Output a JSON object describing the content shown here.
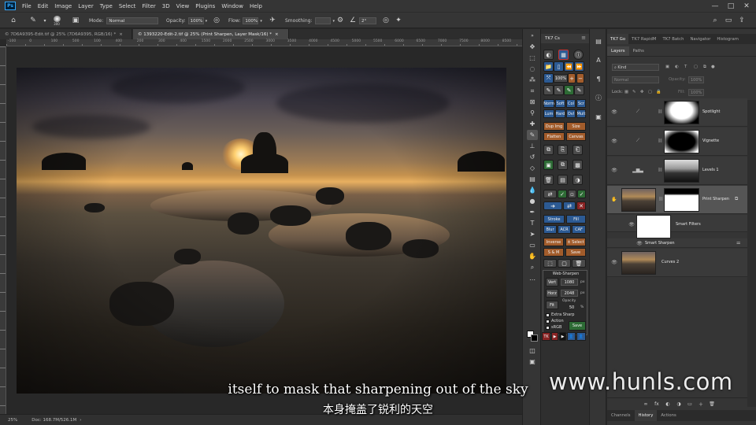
{
  "menubar": {
    "logo": "Ps",
    "items": [
      "File",
      "Edit",
      "Image",
      "Layer",
      "Type",
      "Select",
      "Filter",
      "3D",
      "View",
      "Plugins",
      "Window",
      "Help"
    ],
    "window_controls": [
      "—",
      "□",
      "✕"
    ]
  },
  "options": {
    "brush_size": "300",
    "mode_label": "Mode:",
    "mode_value": "Normal",
    "opacity_label": "Opacity:",
    "opacity_value": "100%",
    "flow_label": "Flow:",
    "flow_value": "100%",
    "smoothing_label": "Smoothing:",
    "angle_value": "2°"
  },
  "document_tabs": [
    {
      "label": "© 7D6A9395-Edit.tif @ 25% (7D6A9395, RGB/16) *",
      "close": "×"
    },
    {
      "label": "© 1393220-Edit-2.tif @ 25% (Print Sharpen, Layer Mask/16) *",
      "close": "×"
    }
  ],
  "ruler_ticks": [
    "-100",
    "0",
    "100",
    "500",
    "100",
    "400",
    "200",
    "300",
    "400",
    "1500",
    "2000",
    "2500",
    "3000",
    "3500",
    "4000",
    "4500",
    "5000",
    "5500",
    "6000",
    "6500",
    "7000",
    "7500",
    "8000",
    "8500"
  ],
  "status": {
    "zoom": "25%",
    "doc_size": "Doc: 168.7M/526.1M"
  },
  "subtitles": {
    "english": "itself to mask that sharpening out of the sky",
    "chinese": "本身掩盖了锐利的天空"
  },
  "watermark": "www.hunls.com",
  "tk7": {
    "tab_label": "TK7 Cs",
    "blend_row1": [
      "Norm",
      "Soft",
      "Col",
      "Scr"
    ],
    "blend_row2": [
      "Lum",
      "Hard",
      "Ovl",
      "Mult"
    ],
    "zoom_value": "100%",
    "dup_img": "Dup Img",
    "size": "Size",
    "flatten": "Flatten",
    "canvas": "Canvas",
    "stroke": "Stroke",
    "fill": "Fill",
    "blur": "Blur",
    "acr": "ACR",
    "caf": "CAF",
    "inverse": "Inverse",
    "select": "± Select",
    "s_m": "S & M",
    "save": "Save",
    "web_sharpen": {
      "title": "Web-Sharpen",
      "vert_label": "Vert",
      "vert_value": "1080",
      "vert_unit": "px",
      "horz_label": "Horz",
      "horz_value": "2048",
      "horz_unit": "px",
      "fit_label": "Fit",
      "opacity_label": "Opacity",
      "opacity_value": "50",
      "opacity_unit": "%",
      "extra_sharp": "Extra Sharp",
      "action": "Action",
      "srgb": "sRGB",
      "save": "Save"
    },
    "footer": [
      "TK",
      "▶",
      "▶",
      "👤",
      "👤"
    ]
  },
  "layers_panel": {
    "top_tabs": [
      "TK7 Go",
      "TK7 RapidM",
      "TK7 Batch",
      "Navigator",
      "Histogram"
    ],
    "sub_tabs": [
      "Layers",
      "Paths"
    ],
    "kind_label": "Kind",
    "blend_mode": "Normal",
    "opacity_label": "Opacity:",
    "opacity_value": "100%",
    "lock_label": "Lock:",
    "fill_label": "Fill:",
    "fill_value": "100%",
    "layers": [
      {
        "name": "Spotlight"
      },
      {
        "name": "Vignette"
      },
      {
        "name": "Levels 1"
      },
      {
        "name": "Print Sharpen"
      },
      {
        "name": "Smart Filters"
      },
      {
        "name": "Smart Sharpen"
      },
      {
        "name": "Curves 2"
      }
    ],
    "footer_icons": [
      "∞",
      "fx",
      "◐",
      "◑",
      "▭",
      "＋",
      "🗑"
    ],
    "bottom_tabs": [
      "Channels",
      "History",
      "Actions"
    ]
  }
}
